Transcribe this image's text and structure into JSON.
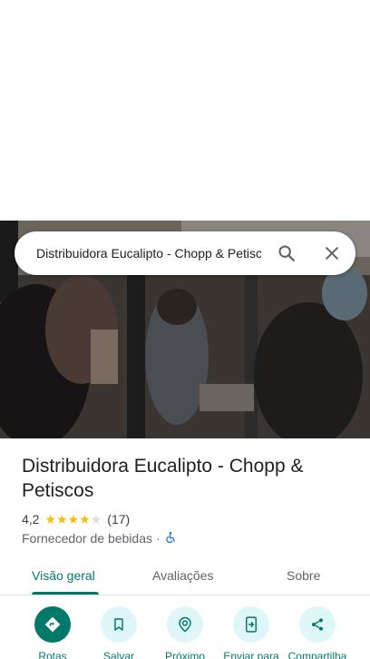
{
  "search": {
    "query": "Distribuidora Eucalipto - Chopp & Petiscos"
  },
  "place": {
    "name": "Distribuidora Eucalipto - Chopp & Petiscos",
    "rating": "4,2",
    "stars_filled": 4,
    "review_count": "(17)",
    "category": "Fornecedor de bebidas",
    "separator": "·"
  },
  "tabs": [
    {
      "label": "Visão geral",
      "active": true
    },
    {
      "label": "Avaliações",
      "active": false
    },
    {
      "label": "Sobre",
      "active": false
    }
  ],
  "actions": [
    {
      "label": "Rotas",
      "icon": "directions-icon"
    },
    {
      "label": "Salvar",
      "icon": "bookmark-icon"
    },
    {
      "label": "Próximo",
      "icon": "nearby-icon"
    },
    {
      "label": "Enviar para",
      "icon": "send-to-phone-icon"
    },
    {
      "label": "Compartilha",
      "icon": "share-icon"
    }
  ],
  "colors": {
    "accent": "#00796b",
    "action_bg": "#e0f7fa",
    "star": "#fbbc04",
    "accessibility": "#1a73e8"
  }
}
